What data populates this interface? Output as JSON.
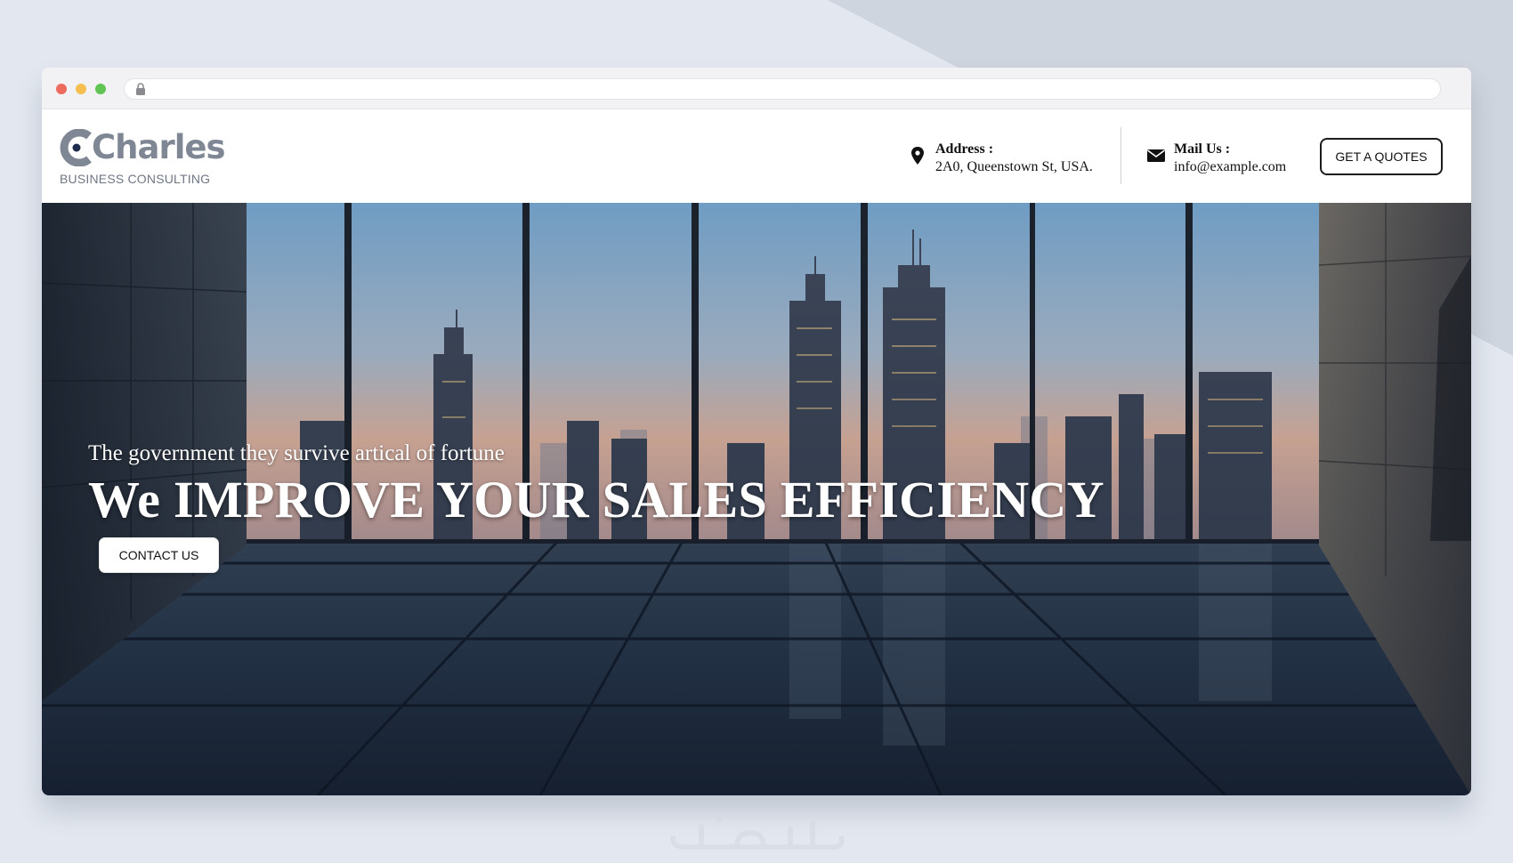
{
  "colors": {
    "background": "#e3e8f0",
    "background_shape": "#cfd5de",
    "logo_gray": "#7f8795",
    "button_border": "#1c1c1c",
    "hero_text": "#ffffff"
  },
  "browser": {
    "url": "",
    "window_controls": [
      "close-dot",
      "minimize-dot",
      "zoom-dot"
    ],
    "lock_icon": "lock-icon"
  },
  "header": {
    "logo": {
      "name": "Charles",
      "tagline": "BUSINESS CONSULTING",
      "icon": "logo-c-mark"
    },
    "address": {
      "icon": "map-pin-icon",
      "label": "Address :",
      "value": "2A0, Queenstown St, USA."
    },
    "mail": {
      "icon": "envelope-icon",
      "label": "Mail Us :",
      "value": "info@example.com"
    },
    "quote_button": "GET A QUOTES"
  },
  "hero": {
    "subtitle": "The government they survive artical of fortune",
    "title": "We IMPROVE YOUR SALES EFFICIENCY",
    "contact_button": "CONTACT US"
  },
  "watermark": {
    "icon": "khamsat-watermark-icon"
  }
}
